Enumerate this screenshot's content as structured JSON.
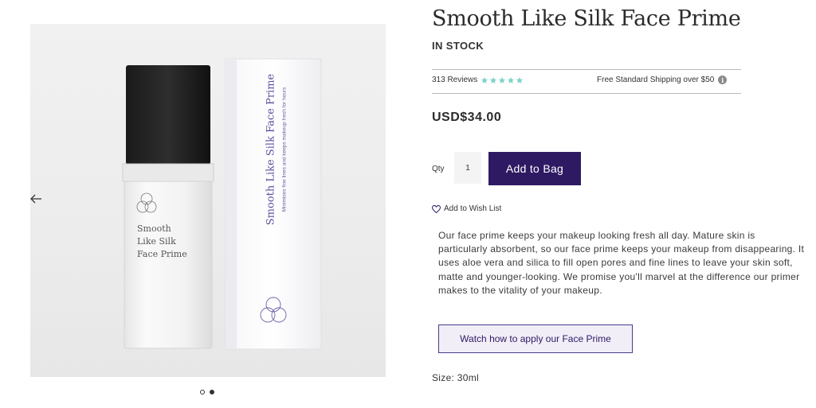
{
  "gallery": {
    "bottle_label": [
      "Smooth",
      "Like Silk",
      "Face Prime"
    ],
    "box_title": "Smooth Like Silk Face Prime",
    "box_subtitle": "Minimises fine lines and keeps makeup fresh for hours",
    "logo_letters": [
      "L",
      "F",
      "F"
    ],
    "dots": [
      {
        "active": false
      },
      {
        "active": true
      }
    ]
  },
  "product": {
    "title": "Smooth Like Silk Face Prime",
    "stock_status": "IN STOCK",
    "reviews_label": "313 Reviews",
    "rating": 5,
    "rating_max": 5,
    "star_color": "#7fd1c8",
    "shipping_label": "Free Standard Shipping over $50",
    "price": "USD$34.00",
    "qty_label": "Qty",
    "qty_value": "1",
    "add_to_bag_label": "Add to Bag",
    "wishlist_label": "Add to Wish List",
    "description": "Our face prime keeps your makeup looking fresh all day. Mature skin is particularly absorbent, so our face prime keeps your makeup from disappearing. It uses aloe vera and silica to fill open pores and fine lines to leave your skin soft, matte and younger-looking. We promise you'll marvel at the difference our primer makes to the vitality of your makeup.",
    "watch_label": "Watch how to apply our Face Prime",
    "size_label": "Size: 30ml"
  },
  "colors": {
    "brand_purple": "#2e1a63",
    "watch_button_bg": "#f1eef8"
  }
}
